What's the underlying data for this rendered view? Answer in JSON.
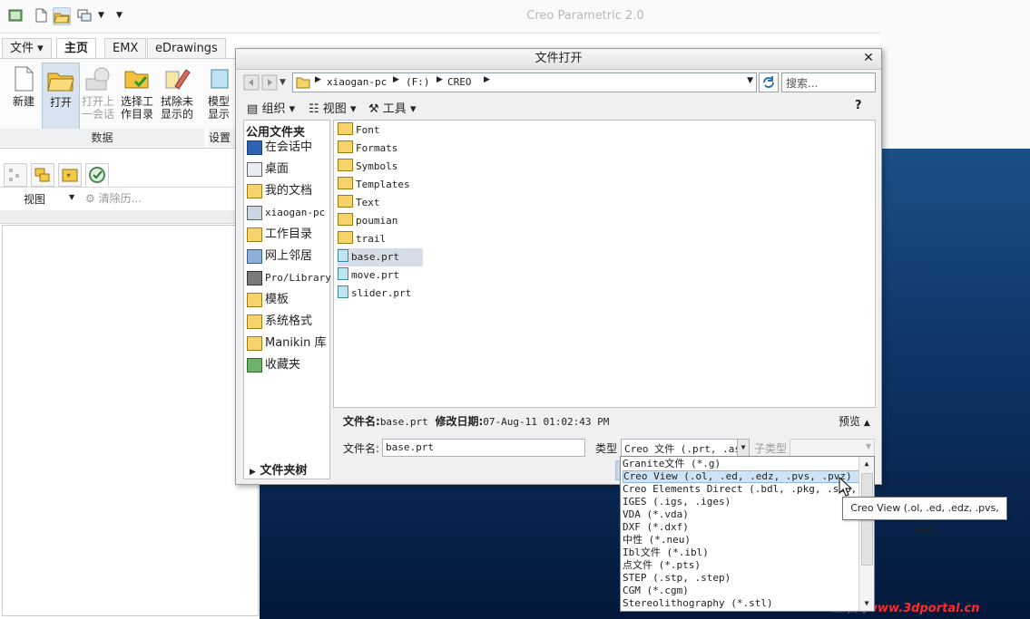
{
  "app": {
    "title": "Creo Parametric 2.0"
  },
  "quick_access": {
    "icons": [
      "window-icon",
      "new-file-icon",
      "open-folder-icon",
      "windows-icon",
      "dropdown-icon",
      "customize-icon"
    ]
  },
  "ribbon": {
    "tabs": [
      "文件",
      "主页",
      "EMX",
      "eDrawings"
    ],
    "buttons": [
      {
        "label_line1": "新建",
        "label_line2": ""
      },
      {
        "label_line1": "打开",
        "label_line2": ""
      },
      {
        "label_line1": "打开上",
        "label_line2": "一会话"
      },
      {
        "label_line1": "选择工",
        "label_line2": "作目录"
      },
      {
        "label_line1": "拭除未",
        "label_line2": "显示的"
      },
      {
        "label_line1": "模型",
        "label_line2": "显示"
      }
    ],
    "group_label": "数据",
    "group_label2": "设置"
  },
  "navigator": {
    "view_label": "视图",
    "clear_history_label": "清除历..."
  },
  "dialog": {
    "title": "文件打开",
    "address": {
      "part1": "xiaogan-pc",
      "part2": "(F:)",
      "part3": "CREO"
    },
    "search_placeholder": "搜索...",
    "toolbar": {
      "organize": "组织",
      "views": "视图",
      "tools": "工具"
    },
    "places_header": "公用文件夹",
    "places": [
      "在会话中",
      "桌面",
      "我的文档",
      "xiaogan-pc",
      "工作目录",
      "网上邻居",
      "Pro/Library",
      "模板",
      "系统格式",
      "Manikin 库",
      "收藏夹"
    ],
    "folder_tree": "文件夹树",
    "files": [
      {
        "name": "Font",
        "kind": "folder"
      },
      {
        "name": "Formats",
        "kind": "folder"
      },
      {
        "name": "Symbols",
        "kind": "folder"
      },
      {
        "name": "Templates",
        "kind": "folder"
      },
      {
        "name": "Text",
        "kind": "folder"
      },
      {
        "name": "poumian",
        "kind": "folder"
      },
      {
        "name": "trail",
        "kind": "folder"
      },
      {
        "name": "base.prt",
        "kind": "part"
      },
      {
        "name": "move.prt",
        "kind": "part"
      },
      {
        "name": "slider.prt",
        "kind": "part"
      }
    ],
    "info": {
      "filename_label": "文件名:",
      "filename_value": "base.prt",
      "date_label": "修改日期:",
      "date_value": "07-Aug-11 01:02:43 PM",
      "preview_label": "预览"
    },
    "filename_field_label": "文件名:",
    "filename_field_value": "base.prt",
    "type_label": "类型",
    "type_value": "Creo 文件 (.prt, .as",
    "subtype_label": "子类型",
    "type_options": [
      "Granite文件 (*.g)",
      "Creo View (.ol, .ed, .edz, .pvs, .pvz)",
      "Creo Elements Direct (.bdl, .pkg, .sdp, .sdd",
      "IGES (.igs, .iges)",
      "VDA (*.vda)",
      "DXF (*.dxf)",
      "中性 (*.neu)",
      "Ibl文件 (*.ibl)",
      "点文件 (*.pts)",
      "STEP (.stp, .step)",
      "CGM (*.cgm)",
      "Stereolithography (*.stl)"
    ],
    "tooltip": "Creo View (.ol, .ed, .edz, .pvs, .pvz)"
  },
  "watermark": "三维网www.3dportal.cn"
}
